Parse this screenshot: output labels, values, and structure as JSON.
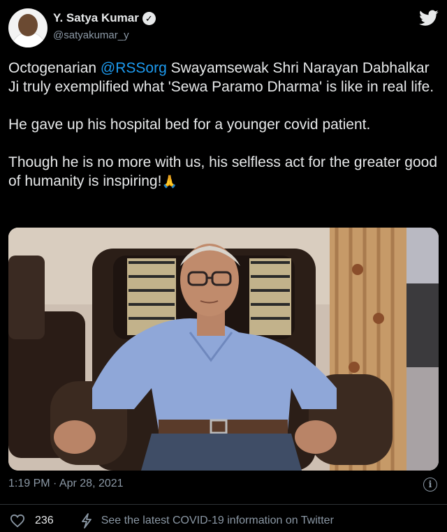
{
  "author": {
    "display_name": "Y. Satya Kumar",
    "handle": "@satyakumar_y",
    "verified": true
  },
  "tweet": {
    "para1": {
      "before": "Octogenarian ",
      "mention": "@RSSorg",
      "after": " Swayamsewak Shri Narayan Dabhalkar Ji truly exemplified what 'Sewa Paramo Dharma' is like in real life."
    },
    "para2": "He gave up his hospital bed for a younger covid patient.",
    "para3": "Though he is no more with us, his selfless act for the greater good of humanity is inspiring!",
    "emoji": "🙏"
  },
  "meta": {
    "timestamp": "1:19 PM · Apr 28, 2021"
  },
  "actions": {
    "like_count": "236",
    "covid_info_link": "See the latest COVID-19 information on Twitter"
  },
  "icons": {
    "brand": "twitter-bird-icon",
    "verified": "verified-badge-icon",
    "info": "info-icon",
    "like": "heart-icon",
    "covid": "lightning-icon"
  },
  "colors": {
    "background": "#000000",
    "text": "#e7e9ea",
    "secondary": "#8b98a5",
    "link": "#1d9bf0",
    "divider": "#2f3336"
  }
}
